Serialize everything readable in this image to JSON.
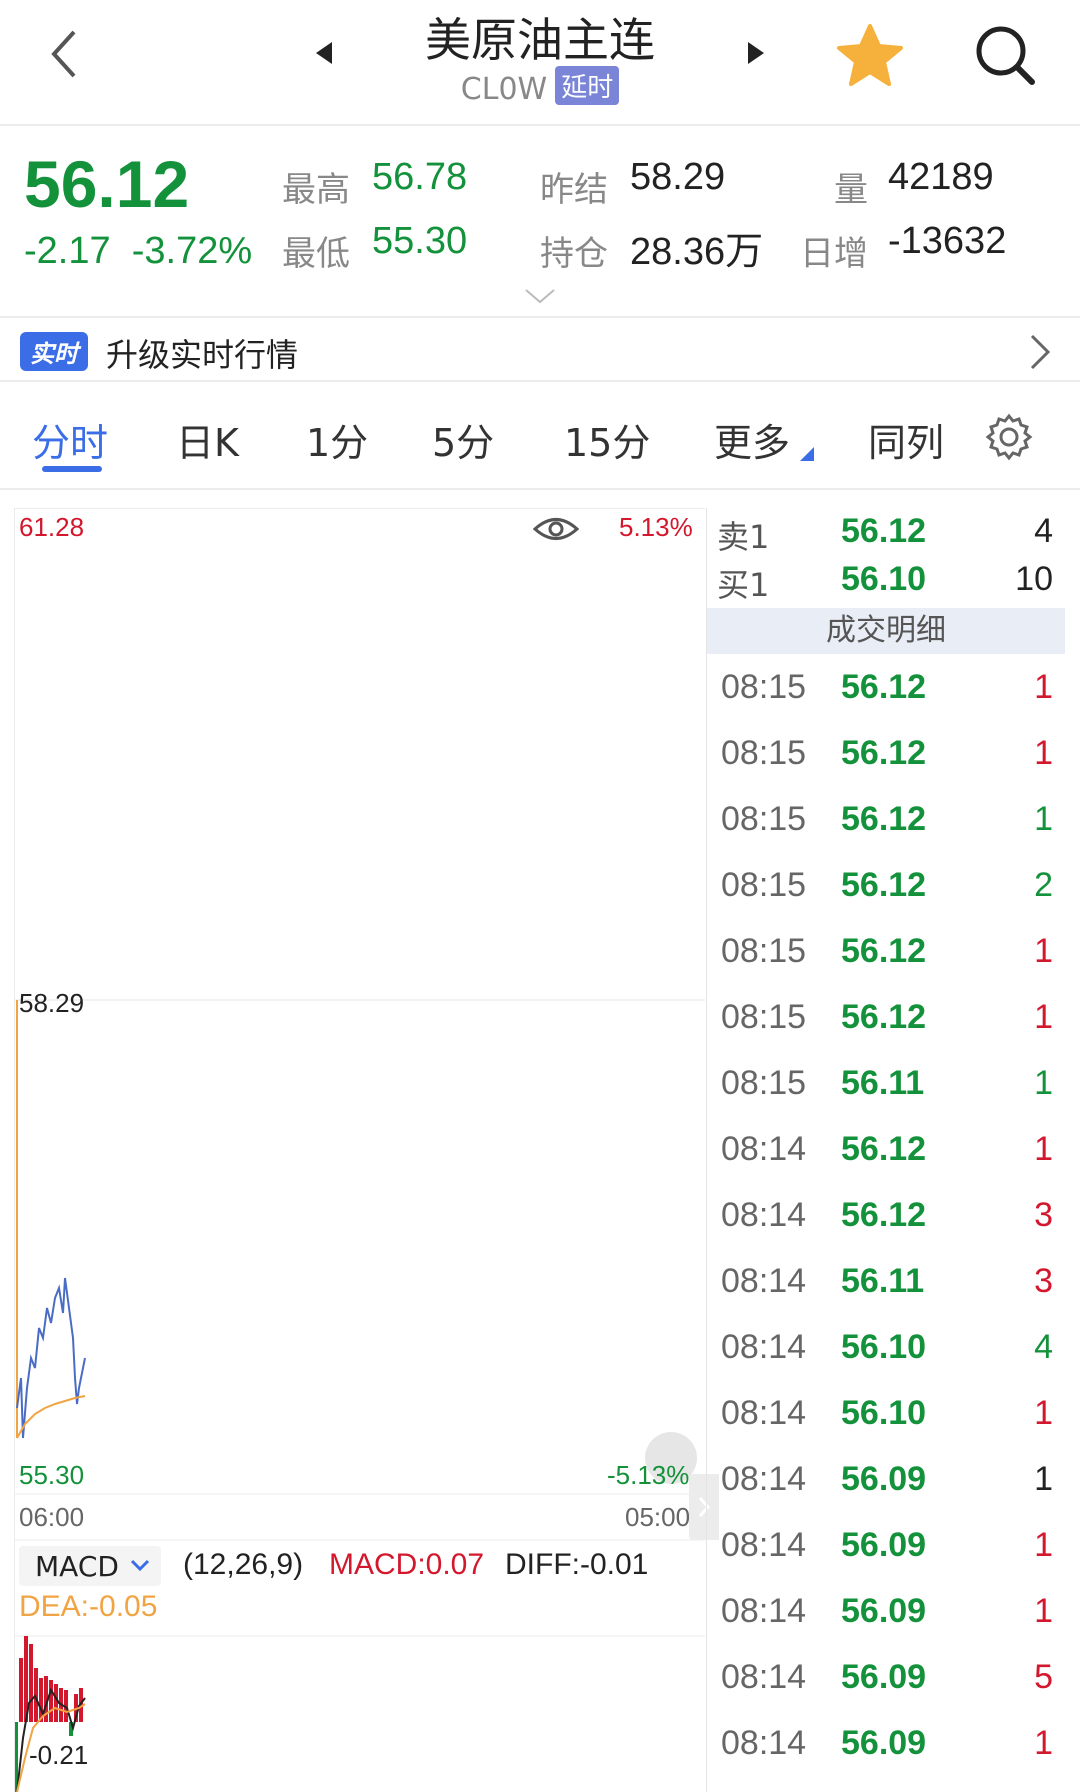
{
  "header": {
    "title": "美原油主连",
    "code": "CL0W",
    "delay_badge": "延时"
  },
  "quote": {
    "price": "56.12",
    "change": "-2.17",
    "change_pct": "-3.72%",
    "high_label": "最高",
    "high": "56.78",
    "low_label": "最低",
    "low": "55.30",
    "prev_settle_label": "昨结",
    "prev_settle": "58.29",
    "open_interest_label": "持仓",
    "open_interest": "28.36万",
    "volume_label": "量",
    "volume": "42189",
    "daily_inc_label": "日增",
    "daily_inc": "-13632"
  },
  "upgrade": {
    "badge": "实时",
    "text": "升级实时行情"
  },
  "tabs": [
    {
      "label": "分时"
    },
    {
      "label": "日K"
    },
    {
      "label": "1分"
    },
    {
      "label": "5分"
    },
    {
      "label": "15分"
    },
    {
      "label": "更多"
    },
    {
      "label": "同列"
    }
  ],
  "chart": {
    "y_max": "61.28",
    "y_max_pct": "5.13%",
    "y_mid": "58.29",
    "y_min": "55.30",
    "y_min_pct": "-5.13%",
    "x_start": "06:00",
    "x_end": "05:00",
    "indicator": "MACD",
    "params": "(12,26,9)",
    "macd": "MACD:0.07",
    "diff": "DIFF:-0.01",
    "dea": "DEA:-0.05",
    "macd_low": "-0.21",
    "colors": {
      "price_line": "#4a6cc4",
      "avg_line": "#f0a443",
      "up": "#d3182e",
      "down": "#13923b"
    }
  },
  "book": {
    "sell": {
      "label": "卖1",
      "price": "56.12",
      "vol": "4"
    },
    "buy": {
      "label": "买1",
      "price": "56.10",
      "vol": "10"
    },
    "detail_title": "成交明细",
    "trades": [
      {
        "time": "08:15",
        "price": "56.12",
        "vol": "1",
        "dir": "red"
      },
      {
        "time": "08:15",
        "price": "56.12",
        "vol": "1",
        "dir": "red"
      },
      {
        "time": "08:15",
        "price": "56.12",
        "vol": "1",
        "dir": "green"
      },
      {
        "time": "08:15",
        "price": "56.12",
        "vol": "2",
        "dir": "green"
      },
      {
        "time": "08:15",
        "price": "56.12",
        "vol": "1",
        "dir": "red"
      },
      {
        "time": "08:15",
        "price": "56.12",
        "vol": "1",
        "dir": "red"
      },
      {
        "time": "08:15",
        "price": "56.11",
        "vol": "1",
        "dir": "green"
      },
      {
        "time": "08:14",
        "price": "56.12",
        "vol": "1",
        "dir": "red"
      },
      {
        "time": "08:14",
        "price": "56.12",
        "vol": "3",
        "dir": "red"
      },
      {
        "time": "08:14",
        "price": "56.11",
        "vol": "3",
        "dir": "red"
      },
      {
        "time": "08:14",
        "price": "56.10",
        "vol": "4",
        "dir": "green"
      },
      {
        "time": "08:14",
        "price": "56.10",
        "vol": "1",
        "dir": "red"
      },
      {
        "time": "08:14",
        "price": "56.09",
        "vol": "1",
        "dir": "dark"
      },
      {
        "time": "08:14",
        "price": "56.09",
        "vol": "1",
        "dir": "red"
      },
      {
        "time": "08:14",
        "price": "56.09",
        "vol": "1",
        "dir": "red"
      },
      {
        "time": "08:14",
        "price": "56.09",
        "vol": "5",
        "dir": "red"
      },
      {
        "time": "08:14",
        "price": "56.09",
        "vol": "1",
        "dir": "red"
      }
    ]
  }
}
